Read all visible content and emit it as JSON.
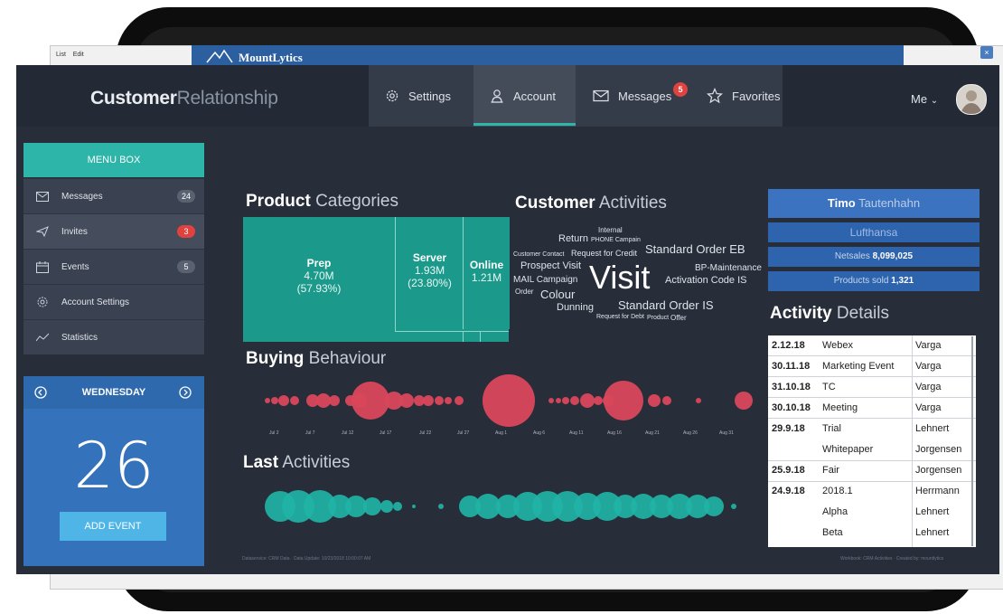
{
  "background_window": {
    "toolbar_items": [
      "List",
      "Edit"
    ],
    "brand": "MountLytics",
    "close_label": "×"
  },
  "header": {
    "logo_bold": "Customer",
    "logo_light": "Relationship",
    "nav": [
      {
        "label": "Settings",
        "icon": "gear-icon"
      },
      {
        "label": "Account",
        "icon": "user-icon",
        "active": true
      },
      {
        "label": "Messages",
        "icon": "envelope-icon",
        "badge": "5"
      },
      {
        "label": "Favorites",
        "icon": "star-icon"
      }
    ],
    "user_label": "Me",
    "user_chevron": "⌄"
  },
  "sidebar": {
    "title": "MENU BOX",
    "items": [
      {
        "label": "Messages",
        "icon": "envelope-icon",
        "count": "24"
      },
      {
        "label": "Invites",
        "icon": "paper-plane-icon",
        "count": "3"
      },
      {
        "label": "Events",
        "icon": "calendar-icon",
        "count": "5"
      },
      {
        "label": "Account Settings",
        "icon": "gear-icon"
      },
      {
        "label": "Statistics",
        "icon": "line-chart-icon"
      }
    ]
  },
  "calendar": {
    "weekday": "WEDNESDAY",
    "day": "26",
    "button": "ADD EVENT",
    "prev_icon": "chevron-left-circle-icon",
    "next_icon": "chevron-right-circle-icon"
  },
  "product_categories": {
    "title_bold": "Product",
    "title_light": "Categories",
    "tiles": [
      {
        "name": "Prep",
        "value": "4.70M",
        "share": "(57.93%)"
      },
      {
        "name": "Server",
        "value": "1.93M",
        "share": "(23.80%)"
      },
      {
        "name": "Online",
        "value": "1.21M",
        "share": ""
      }
    ]
  },
  "customer_activities": {
    "title_bold": "Customer",
    "title_light": "Activities",
    "words": [
      "Internal",
      "Return",
      "PHONE Campain",
      "Standard Order EB",
      "Customer Contact",
      "Request for Credit",
      "Prospect Visit",
      "BP-Maintenance",
      "MAIL Campaign",
      "Visit",
      "Activation Code IS",
      "Order",
      "Colour",
      "Standard Order IS",
      "Dunning",
      "Request for Debt",
      "Product",
      "Offer"
    ]
  },
  "buying_behaviour": {
    "title_bold": "Buying",
    "title_light": "Behaviour",
    "ticks": [
      "Jul 2",
      "Jul 7",
      "Jul 12",
      "Jul 17",
      "Jul 22",
      "Jul 27",
      "Aug 1",
      "Aug 6",
      "Aug 11",
      "Aug 16",
      "Aug 21",
      "Aug 26",
      "Aug 31"
    ],
    "color": "#d9475b"
  },
  "last_activities": {
    "title_bold": "Last",
    "title_light": "Activities",
    "color": "#1fb3a6"
  },
  "account_panel": {
    "name_bold": "Timo",
    "name_light": "Tautenhahn",
    "company": "Lufthansa",
    "netsales_label": "Netsales",
    "netsales_value": "8,099,025",
    "products_label": "Products sold",
    "products_value": "1,321"
  },
  "activity_details": {
    "title_bold": "Activity",
    "title_light": "Details",
    "rows": [
      {
        "date": "2.12.18",
        "event": "Webex",
        "person": "Varga"
      },
      {
        "date": "30.11.18",
        "event": "Marketing Event",
        "person": "Varga"
      },
      {
        "date": "31.10.18",
        "event": "TC",
        "person": "Varga"
      },
      {
        "date": "30.10.18",
        "event": "Meeting",
        "person": "Varga"
      },
      {
        "date": "29.9.18",
        "event": "Trial",
        "person": "Lehnert"
      },
      {
        "date": "",
        "event": "Whitepaper",
        "person": "Jorgensen"
      },
      {
        "date": "25.9.18",
        "event": "Fair",
        "person": "Jorgensen"
      },
      {
        "date": "24.9.18",
        "event": "2018.1",
        "person": "Herrmann"
      },
      {
        "date": "",
        "event": "Alpha",
        "person": "Lehnert"
      },
      {
        "date": "",
        "event": "Beta",
        "person": "Lehnert"
      }
    ]
  },
  "footer": {
    "left": "Dataservice: CRM Data · Data Update: 10/23/2018 10:00:07 AM",
    "right": "Workbook: CRM Activities · Created by: mountlytics"
  },
  "accent": "#2cb5a8"
}
